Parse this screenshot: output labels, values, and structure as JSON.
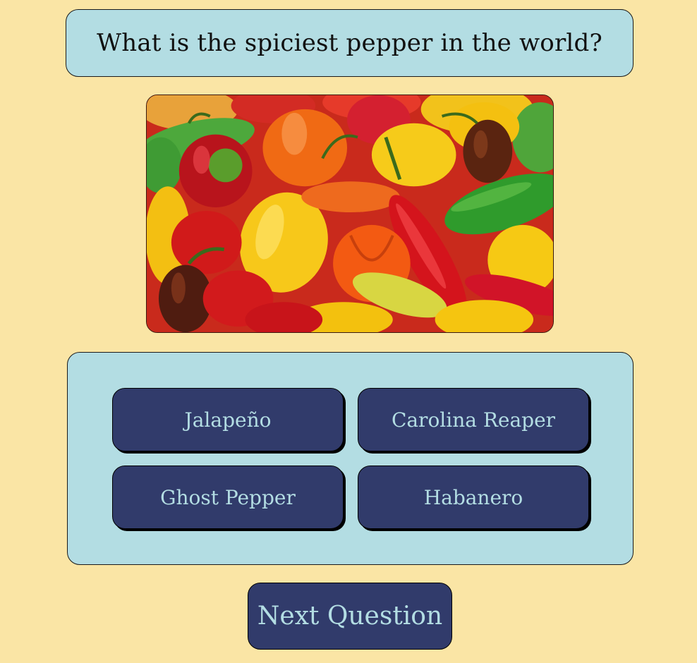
{
  "quiz": {
    "question": "What is the spiciest pepper in the world?",
    "answers": [
      "Jalapeño",
      "Carolina Reaper",
      "Ghost Pepper",
      "Habanero"
    ],
    "next_label": "Next Question"
  },
  "image": {
    "subject": "assorted colorful chili peppers"
  },
  "colors": {
    "background": "#fae5a5",
    "panel": "#b3dde3",
    "button": "#313b6b",
    "button_text": "#b3dde3"
  }
}
